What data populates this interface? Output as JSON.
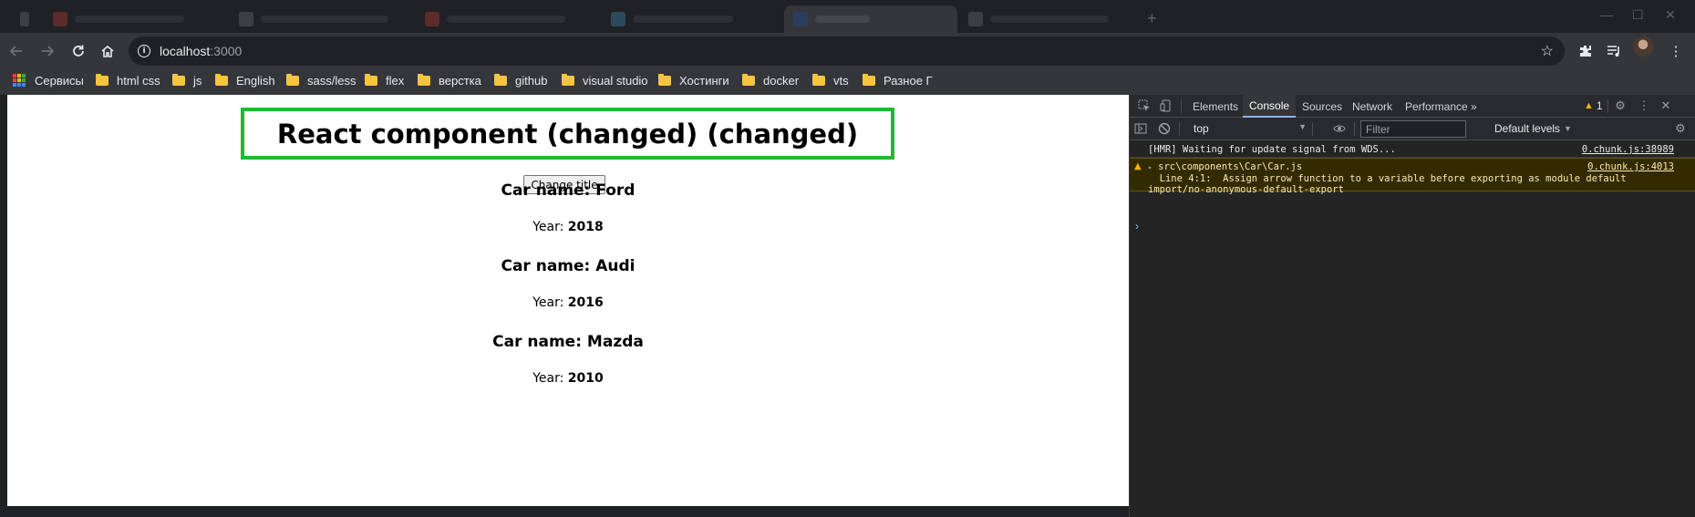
{
  "browser": {
    "url_host": "localhost",
    "url_port": ":3000"
  },
  "bookmarks": [
    {
      "label": "Сервисы",
      "icon": "apps-grid-icon"
    },
    {
      "label": "html css",
      "icon": "folder-icon"
    },
    {
      "label": "js",
      "icon": "folder-icon"
    },
    {
      "label": "English",
      "icon": "folder-icon"
    },
    {
      "label": "sass/less",
      "icon": "folder-icon"
    },
    {
      "label": "flex",
      "icon": "folder-icon"
    },
    {
      "label": "верстка",
      "icon": "folder-icon"
    },
    {
      "label": "github",
      "icon": "folder-icon"
    },
    {
      "label": "visual studio",
      "icon": "folder-icon"
    },
    {
      "label": "Хостинги",
      "icon": "folder-icon"
    },
    {
      "label": "docker",
      "icon": "folder-icon"
    },
    {
      "label": "vts",
      "icon": "folder-icon"
    },
    {
      "label": "Разное Г",
      "icon": "folder-icon"
    }
  ],
  "page": {
    "title": "React component (changed) (changed)",
    "button_label": "Change title",
    "year_label": "Year:",
    "cars": [
      {
        "name": "Car name: Ford",
        "year": "2018"
      },
      {
        "name": "Car name: Audi",
        "year": "2016"
      },
      {
        "name": "Car name: Mazda",
        "year": "2010"
      }
    ]
  },
  "devtools": {
    "tabs": [
      "Elements",
      "Console",
      "Sources",
      "Network",
      "Performance"
    ],
    "active_tab": "Console",
    "more_tabs": "»",
    "warning_count": "1",
    "context": "top",
    "filter_placeholder": "Filter",
    "levels": "Default levels",
    "messages": {
      "log": {
        "text": "[HMR] Waiting for update signal from WDS...",
        "source": "0.chunk.js:38989"
      },
      "warn": {
        "line1": "src\\components\\Car\\Car.js",
        "line2": "  Line 4:1:  Assign arrow function to a variable before exporting as module default",
        "line3": "import/no-anonymous-default-export",
        "source": "0.chunk.js:4013"
      }
    },
    "prompt": "›"
  },
  "colors": {
    "title_border": "#1fb934",
    "warning": "#f4b400",
    "active_tab_underline": "#8ab4f8"
  }
}
